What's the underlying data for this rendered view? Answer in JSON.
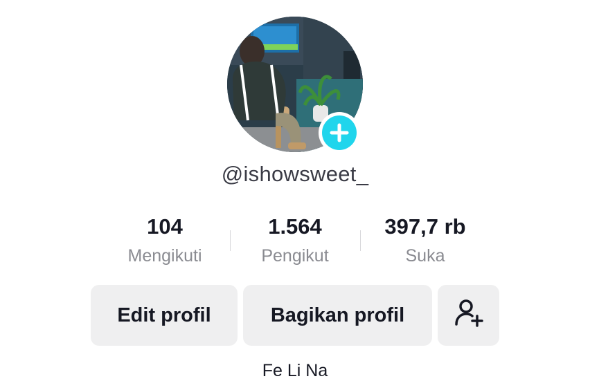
{
  "profile": {
    "username": "@ishowsweet_",
    "bio": "Fe Li Na"
  },
  "stats": [
    {
      "value": "104",
      "label": "Mengikuti"
    },
    {
      "value": "1.564",
      "label": "Pengikut"
    },
    {
      "value": "397,7 rb",
      "label": "Suka"
    }
  ],
  "buttons": {
    "edit_label": "Edit profil",
    "share_label": "Bagikan profil"
  },
  "icons": {
    "avatar_add": "plus-icon",
    "add_friend": "add-user-icon"
  },
  "colors": {
    "accent": "#20d5ec",
    "button_bg": "#efeff0",
    "text_primary": "#161823",
    "text_secondary": "#8a8b91"
  }
}
